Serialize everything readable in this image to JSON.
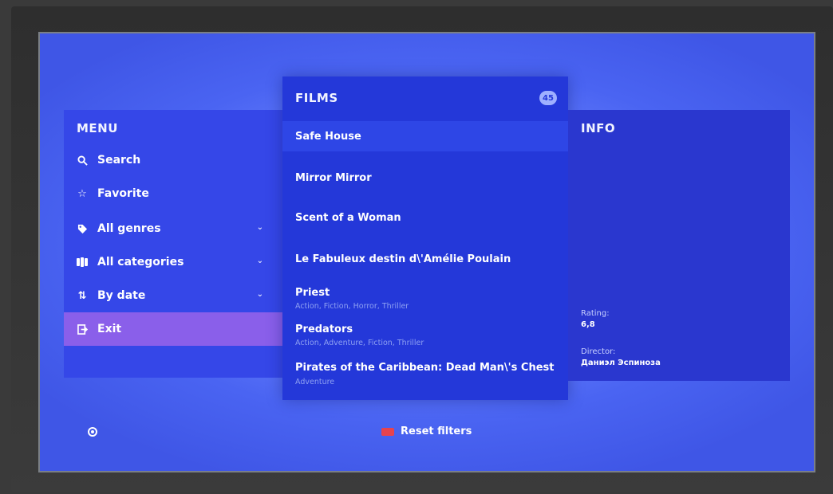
{
  "menu": {
    "title": "MENU",
    "items": [
      {
        "label": "Search",
        "icon": "search-icon",
        "chevron": false
      },
      {
        "label": "Favorite",
        "icon": "star-icon",
        "chevron": false
      },
      {
        "label": "All genres",
        "icon": "tag-icon",
        "chevron": true
      },
      {
        "label": "All categories",
        "icon": "categories-icon",
        "chevron": true
      },
      {
        "label": "By date",
        "icon": "sort-icon",
        "chevron": true
      },
      {
        "label": "Exit",
        "icon": "exit-icon",
        "chevron": false,
        "active": true
      }
    ]
  },
  "films": {
    "title": "FILMS",
    "count": "45",
    "items": [
      {
        "title": "Safe House",
        "genres": ""
      },
      {
        "title": "Mirror Mirror",
        "genres": ""
      },
      {
        "title": "Scent of a Woman",
        "genres": ""
      },
      {
        "title": "Le Fabuleux destin d\\'Amélie Poulain",
        "genres": ""
      },
      {
        "title": "Priest",
        "genres": "Action, Fiction, Horror, Thriller"
      },
      {
        "title": "Predators",
        "genres": "Action, Adventure, Fiction, Thriller"
      },
      {
        "title": "Pirates of the Caribbean: Dead Man\\'s Chest",
        "genres": "Adventure"
      }
    ]
  },
  "info": {
    "title": "INFO",
    "rating_label": "Rating:",
    "rating_value": "6,8",
    "director_label": "Director:",
    "director_value": "Даниэл Эспиноза"
  },
  "footer": {
    "reset_label": "Reset filters"
  },
  "colors": {
    "accent_active": "#8a5fea",
    "reset_key": "#e6434f"
  }
}
